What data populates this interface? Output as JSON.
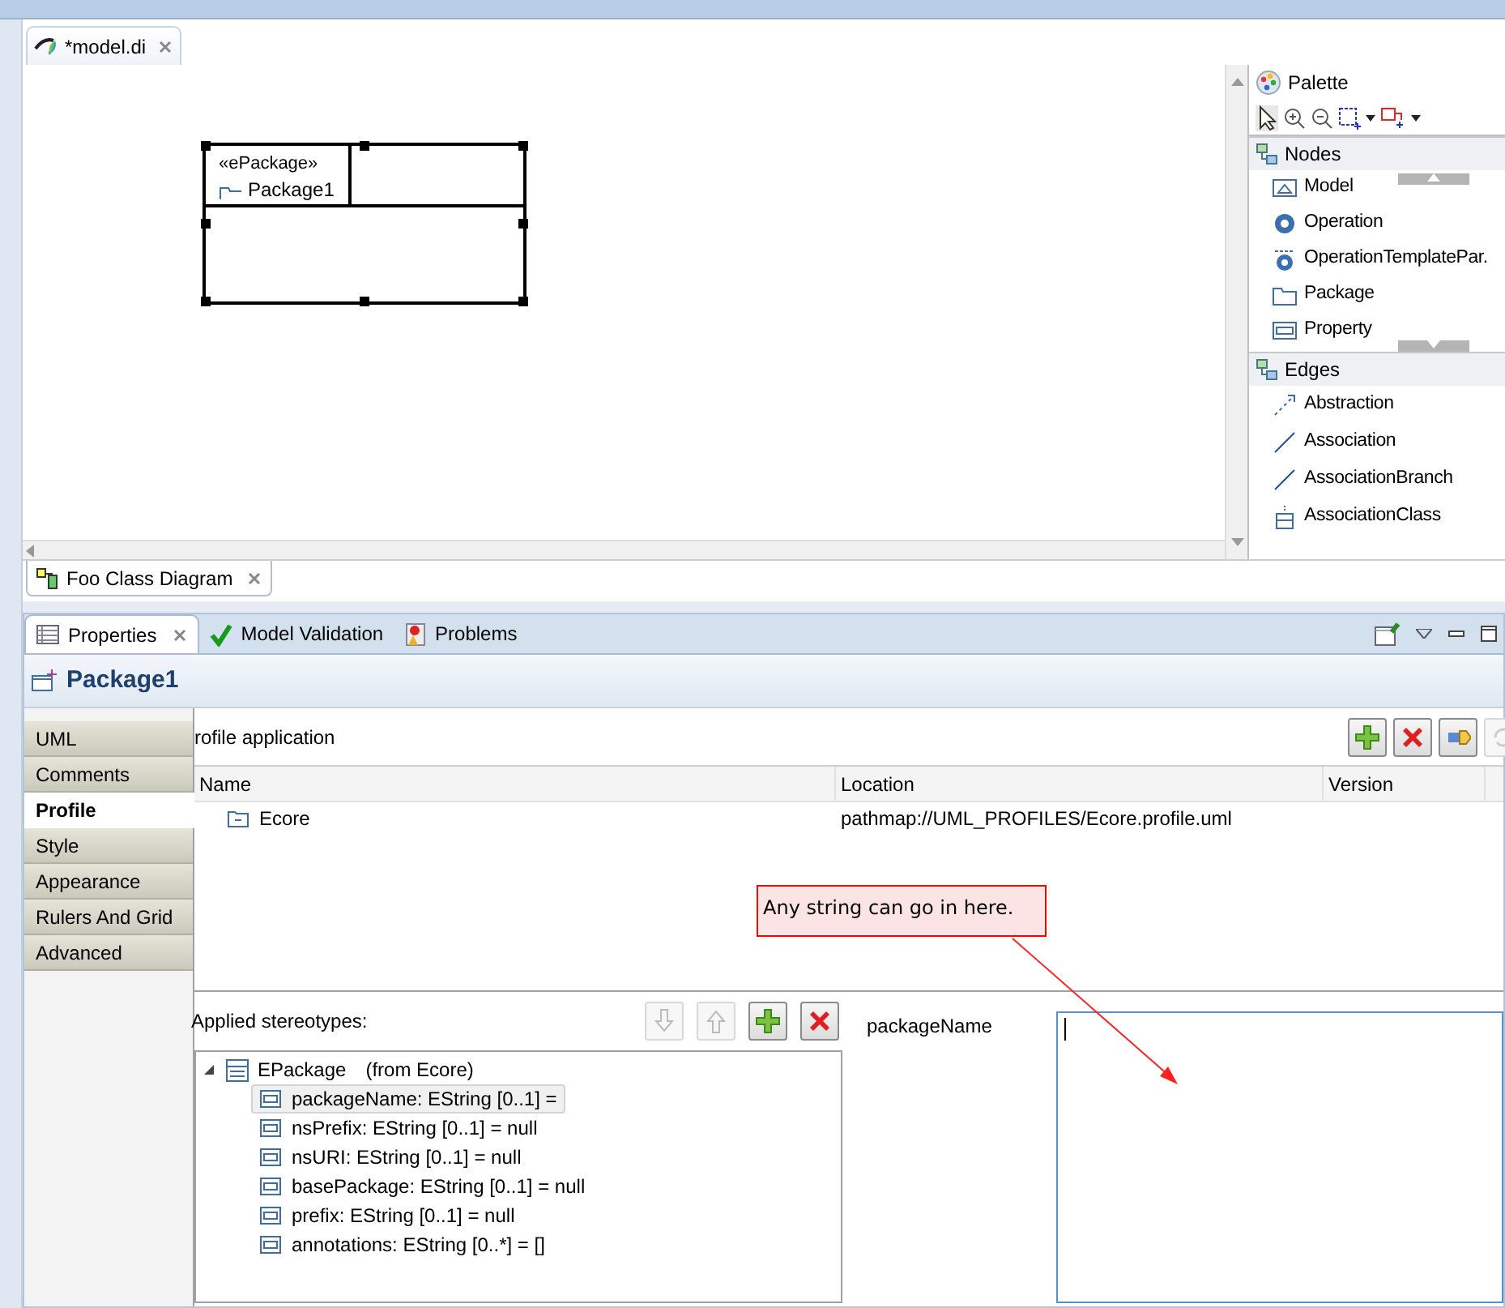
{
  "editor_tab": {
    "title": "*model.di"
  },
  "diagram": {
    "stereotype": "«ePackage»",
    "name": "Package1",
    "selected": true
  },
  "palette": {
    "title": "Palette",
    "drawers": [
      {
        "title": "Nodes",
        "items": [
          {
            "label": "Model",
            "kind": "model"
          },
          {
            "label": "Operation",
            "kind": "gear"
          },
          {
            "label": "OperationTemplatePar.",
            "kind": "template"
          },
          {
            "label": "Package",
            "kind": "package"
          },
          {
            "label": "Property",
            "kind": "property"
          }
        ]
      },
      {
        "title": "Edges",
        "items": [
          {
            "label": "Abstraction",
            "kind": "dashed"
          },
          {
            "label": "Association",
            "kind": "line"
          },
          {
            "label": "AssociationBranch",
            "kind": "line"
          },
          {
            "label": "AssociationClass",
            "kind": "class"
          }
        ]
      }
    ]
  },
  "diagram_tab": {
    "title": "Foo Class Diagram"
  },
  "view_tabs": [
    {
      "label": "Properties",
      "kind": "table",
      "selected": true
    },
    {
      "label": "Model Validation",
      "kind": "check",
      "selected": false
    },
    {
      "label": "Problems",
      "kind": "problems",
      "selected": false
    }
  ],
  "properties": {
    "title": "Package1",
    "sections": [
      {
        "label": "UML",
        "selected": false
      },
      {
        "label": "Comments",
        "selected": false
      },
      {
        "label": "Profile",
        "selected": true
      },
      {
        "label": "Style",
        "selected": false
      },
      {
        "label": "Appearance",
        "selected": false
      },
      {
        "label": "Rulers And Grid",
        "selected": false
      },
      {
        "label": "Advanced",
        "selected": false
      }
    ],
    "profile_application": {
      "label": "rofile application",
      "buttons": [
        {
          "kind": "add",
          "disabled": false
        },
        {
          "kind": "remove",
          "disabled": false
        },
        {
          "kind": "apply",
          "disabled": false
        },
        {
          "kind": "refresh",
          "disabled": true
        }
      ],
      "columns": [
        "Name",
        "Location",
        "Version"
      ],
      "rows": [
        {
          "name": "Ecore",
          "location": "pathmap://UML_PROFILES/Ecore.profile.uml"
        }
      ]
    },
    "stereotypes": {
      "label": "Applied stereotypes:",
      "buttons": [
        {
          "kind": "down",
          "disabled": true
        },
        {
          "kind": "up",
          "disabled": true
        },
        {
          "kind": "add",
          "disabled": false
        },
        {
          "kind": "remove",
          "disabled": false
        }
      ],
      "tree": [
        {
          "label": "EPackage",
          "source": "(from Ecore)",
          "expanded": true,
          "children": [
            {
              "label": "packageName: EString [0..1] =",
              "selected": true
            },
            {
              "label": "nsPrefix: EString [0..1] = null",
              "selected": false
            },
            {
              "label": "nsURI: EString [0..1] = null",
              "selected": false
            },
            {
              "label": "basePackage: EString [0..1] = null",
              "selected": false
            },
            {
              "label": "prefix: EString [0..1] = null",
              "selected": false
            },
            {
              "label": "annotations: EString [0..*] = []",
              "selected": false
            }
          ]
        }
      ]
    },
    "value": {
      "label": "packageName",
      "focused": true
    }
  },
  "callout": {
    "text": "Any string can go in here."
  }
}
